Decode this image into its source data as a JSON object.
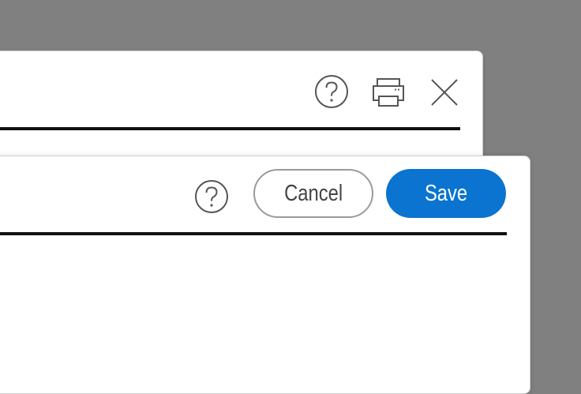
{
  "backdrop": {
    "color": "#808080"
  },
  "back_dialog": {
    "icons": {
      "help": "help-circle-icon",
      "print": "printer-icon",
      "close": "close-icon"
    }
  },
  "front_dialog": {
    "icons": {
      "help": "help-circle-icon"
    },
    "cancel_label": "Cancel",
    "save_label": "Save"
  },
  "colors": {
    "accent": "#0a74d0",
    "rule": "#111111",
    "icon": "#555555",
    "cancel_border": "#9a9a9a"
  }
}
